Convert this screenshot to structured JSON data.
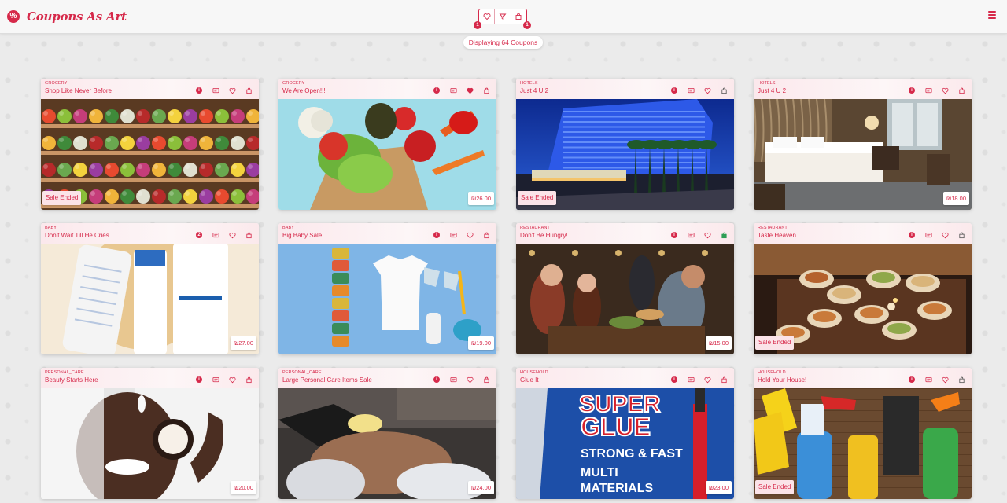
{
  "header": {
    "brand": "Coupons As Art",
    "logo_glyph": "%",
    "filter_badges": [
      "1",
      "1"
    ]
  },
  "status": {
    "display_text": "Displaying 64 Coupons"
  },
  "colors": {
    "accent": "#d6294a",
    "favorite": "#d6294a",
    "cart_active": "#2e9e55",
    "cart_default": "#555555"
  },
  "coupons": [
    {
      "category": "GROCERY",
      "title": "Shop Like Never Before",
      "status": "Sale Ended",
      "price": "",
      "favorited": false,
      "in_cart": false,
      "cart_dark": false,
      "info_icon": "i",
      "image": "grocery-shelves"
    },
    {
      "category": "GROCERY",
      "title": "We Are Open!!!",
      "status": "",
      "price": "₪26.00",
      "favorited": true,
      "in_cart": false,
      "cart_dark": false,
      "info_icon": "i",
      "image": "vegetables-bag"
    },
    {
      "category": "HOTELS",
      "title": "Just 4 U 2",
      "status": "Sale Ended",
      "price": "",
      "favorited": false,
      "in_cart": false,
      "cart_dark": true,
      "info_icon": "i",
      "image": "hotel-night"
    },
    {
      "category": "HOTELS",
      "title": "Just 4 U 2",
      "status": "",
      "price": "₪18.00",
      "favorited": false,
      "in_cart": false,
      "cart_dark": false,
      "info_icon": "i",
      "image": "hotel-room"
    },
    {
      "category": "BABY",
      "title": "Don't Wait Till He Cries",
      "status": "",
      "price": "₪27.00",
      "favorited": false,
      "in_cart": false,
      "cart_dark": false,
      "info_icon": "2",
      "image": "baby-lotions"
    },
    {
      "category": "BABY",
      "title": "Big Baby Sale",
      "status": "",
      "price": "₪19.00",
      "favorited": false,
      "in_cart": false,
      "cart_dark": false,
      "info_icon": "i",
      "image": "baby-items"
    },
    {
      "category": "RESTAURANT",
      "title": "Don't Be Hungry!",
      "status": "",
      "price": "₪15.00",
      "favorited": false,
      "in_cart": true,
      "cart_dark": false,
      "info_icon": "i",
      "image": "restaurant-people"
    },
    {
      "category": "RESTAURANT",
      "title": "Taste Heaven",
      "status": "Sale Ended",
      "price": "",
      "favorited": false,
      "in_cart": false,
      "cart_dark": true,
      "info_icon": "i",
      "image": "restaurant-table"
    },
    {
      "category": "PERSONAL_CARE",
      "title": "Beauty Starts Here",
      "status": "",
      "price": "₪20.00",
      "favorited": false,
      "in_cart": false,
      "cart_dark": false,
      "info_icon": "i",
      "image": "beauty-cream"
    },
    {
      "category": "PERSONAL_CARE",
      "title": "Large Personal Care Items Sale",
      "status": "",
      "price": "₪24.00",
      "favorited": false,
      "in_cart": false,
      "cart_dark": false,
      "info_icon": "i",
      "image": "facial-treatment"
    },
    {
      "category": "HOUSEHOLD",
      "title": "Glue It",
      "status": "",
      "price": "₪23.00",
      "favorited": false,
      "in_cart": false,
      "cart_dark": false,
      "info_icon": "i",
      "image": "super-glue",
      "image_text": [
        "SUPER",
        "GLUE",
        "STRONG & FAST",
        "MULTI",
        "MATERIALS"
      ]
    },
    {
      "category": "HOUSEHOLD",
      "title": "Hold Your House!",
      "status": "Sale Ended",
      "price": "",
      "favorited": false,
      "in_cart": false,
      "cart_dark": true,
      "info_icon": "i",
      "image": "cleaning-supplies"
    }
  ]
}
